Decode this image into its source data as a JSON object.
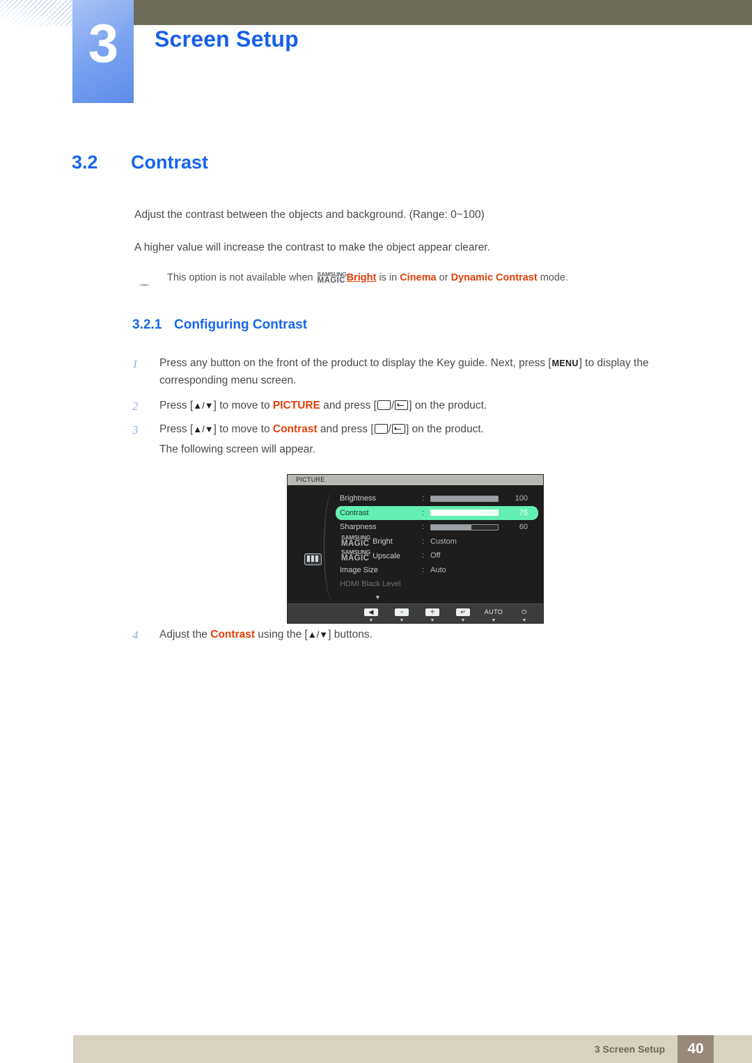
{
  "header": {
    "chapter_number": "3",
    "chapter_title": "Screen Setup"
  },
  "section": {
    "number": "3.2",
    "title": "Contrast",
    "paragraph_1": "Adjust the contrast between the objects and background. (Range: 0~100)",
    "paragraph_2": "A higher value will increase the contrast to make the object appear clearer.",
    "note": {
      "text_before": "This option is not available when",
      "logo_line1": "SAMSUNG",
      "logo_line2": "MAGIC",
      "emphasis_1": "Bright",
      "text_mid_1": "is in",
      "emphasis_2": "Cinema",
      "text_mid_2": "or",
      "emphasis_3": "Dynamic Contrast",
      "text_after": "mode."
    }
  },
  "subsection": {
    "number": "3.2.1",
    "title": "Configuring Contrast"
  },
  "steps": [
    {
      "index": "1",
      "part_1": "Press any button on the front of the product to display the Key guide. Next, press [",
      "keycap": "MENU",
      "part_2": "] to display the corresponding menu screen."
    },
    {
      "index": "2",
      "part_1": "Press [",
      "arrows": "▲/▼",
      "part_2": "] to move to",
      "emphasis": "PICTURE",
      "part_3": "and press [",
      "part_4": "] on the product."
    },
    {
      "index": "3",
      "part_1": "Press [",
      "arrows": "▲/▼",
      "part_2": "] to move to",
      "emphasis": "Contrast",
      "part_3": "and press [",
      "part_4": "] on the product.",
      "follow_up": "The following screen will appear."
    },
    {
      "index": "4",
      "part_1": "Adjust the",
      "emphasis": "Contrast",
      "part_2": "using the [",
      "arrows": "▲/▼",
      "part_3": "] buttons."
    }
  ],
  "osd": {
    "title": "PICTURE",
    "menu_icon": "picture-sliders-icon",
    "scroll_down_glyph": "▼",
    "rows": [
      {
        "label": "Brightness",
        "colon": ":",
        "type": "slider",
        "value": "100",
        "fill_percent": 100,
        "highlighted": false
      },
      {
        "label": "Contrast",
        "colon": ":",
        "type": "slider",
        "value": "75",
        "fill_percent": 75,
        "highlighted": true
      },
      {
        "label": "Sharpness",
        "colon": ":",
        "type": "slider",
        "value": "60",
        "fill_percent": 60,
        "highlighted": false
      },
      {
        "label_logo1": "SAMSUNG",
        "label_logo2": "MAGIC",
        "label": "Bright",
        "colon": ":",
        "type": "text",
        "value": "Custom",
        "highlighted": false
      },
      {
        "label_logo1": "SAMSUNG",
        "label_logo2": "MAGIC",
        "label": "Upscale",
        "colon": ":",
        "type": "text",
        "value": "Off",
        "highlighted": false
      },
      {
        "label": "Image Size",
        "colon": ":",
        "type": "text",
        "value": "Auto",
        "highlighted": false
      },
      {
        "label": "HDMI Black Level",
        "colon": "",
        "type": "text",
        "value": "",
        "highlighted": false,
        "dim": true
      }
    ],
    "footer_buttons": [
      {
        "name": "left-arrow-button",
        "glyph": "◀",
        "caret": "▼"
      },
      {
        "name": "minus-button",
        "glyph": "−",
        "caret": "▼"
      },
      {
        "name": "plus-button",
        "glyph": "＋",
        "caret": "▼"
      },
      {
        "name": "enter-button",
        "glyph": "↵",
        "caret": "▼"
      },
      {
        "name": "auto-button",
        "glyph": "AUTO",
        "caret": "▼",
        "is_text": true
      },
      {
        "name": "power-button",
        "glyph": "⏻",
        "caret": "▼",
        "is_text": true
      }
    ]
  },
  "footer": {
    "label": "3 Screen Setup",
    "page_number": "40"
  },
  "colors": {
    "accent_blue": "#1766ee",
    "emphasis_orange": "#e0400a",
    "header_bar": "#6d6c58",
    "footer_band": "#d8d2c0",
    "page_box": "#97897c",
    "osd_highlight": "#64f0b4"
  }
}
